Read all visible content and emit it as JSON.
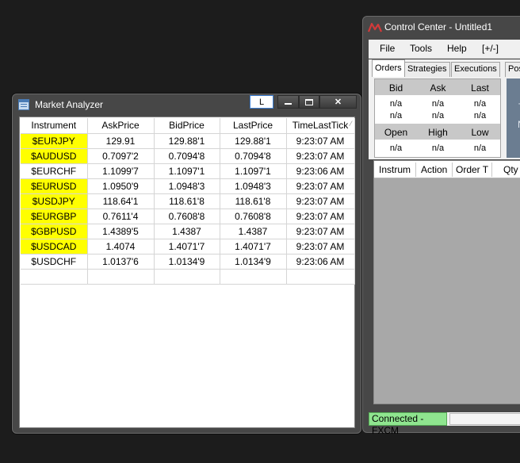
{
  "market_analyzer": {
    "title": "Market Analyzer",
    "toolbar_button": "L",
    "close_glyph": "✕",
    "sort_glyph": "⁄",
    "columns": [
      "Instrument",
      "AskPrice",
      "BidPrice",
      "LastPrice",
      "TimeLastTick"
    ],
    "highlight_color": "#ffff00",
    "rows": [
      {
        "instrument": "$EURJPY",
        "ask": "129.91",
        "bid": "129.88'1",
        "last": "129.88'1",
        "time": "9:23:07 AM",
        "highlighted": true
      },
      {
        "instrument": "$AUDUSD",
        "ask": "0.7097'2",
        "bid": "0.7094'8",
        "last": "0.7094'8",
        "time": "9:23:07 AM",
        "highlighted": true
      },
      {
        "instrument": "$EURCHF",
        "ask": "1.1099'7",
        "bid": "1.1097'1",
        "last": "1.1097'1",
        "time": "9:23:06 AM",
        "highlighted": false
      },
      {
        "instrument": "$EURUSD",
        "ask": "1.0950'9",
        "bid": "1.0948'3",
        "last": "1.0948'3",
        "time": "9:23:07 AM",
        "highlighted": true
      },
      {
        "instrument": "$USDJPY",
        "ask": "118.64'1",
        "bid": "118.61'8",
        "last": "118.61'8",
        "time": "9:23:07 AM",
        "highlighted": true
      },
      {
        "instrument": "$EURGBP",
        "ask": "0.7611'4",
        "bid": "0.7608'8",
        "last": "0.7608'8",
        "time": "9:23:07 AM",
        "highlighted": true
      },
      {
        "instrument": "$GBPUSD",
        "ask": "1.4389'5",
        "bid": "1.4387",
        "last": "1.4387",
        "time": "9:23:07 AM",
        "highlighted": true
      },
      {
        "instrument": "$USDCAD",
        "ask": "1.4074",
        "bid": "1.4071'7",
        "last": "1.4071'7",
        "time": "9:23:07 AM",
        "highlighted": true
      },
      {
        "instrument": "$USDCHF",
        "ask": "1.0137'6",
        "bid": "1.0134'9",
        "last": "1.0134'9",
        "time": "9:23:06 AM",
        "highlighted": false
      }
    ]
  },
  "control_center": {
    "title": "Control Center - Untitled1",
    "menu": [
      "File",
      "Tools",
      "Help",
      "[+/-]"
    ],
    "tabs": [
      "Orders",
      "Strategies",
      "Executions",
      "Pos"
    ],
    "active_tab": "Orders",
    "quote_headers_top": [
      "Bid",
      "Ask",
      "Last"
    ],
    "quote_values_row1": [
      "n/a",
      "n/a",
      "n/a"
    ],
    "quote_values_row2": [
      "n/a",
      "n/a",
      "n/a"
    ],
    "quote_headers_bottom": [
      "Open",
      "High",
      "Low"
    ],
    "quote_values_row3": [
      "n/a",
      "n/a",
      "n/a"
    ],
    "side_letters": [
      "T",
      "N"
    ],
    "order_columns": [
      "Instrum",
      "Action",
      "Order T",
      "Qty"
    ],
    "status": "Connected - FXCM",
    "status_color": "#8fe58f"
  }
}
